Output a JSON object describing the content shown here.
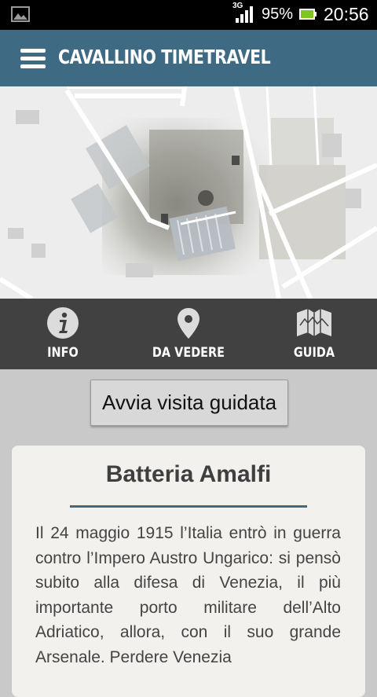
{
  "status_bar": {
    "network_label": "3G",
    "battery_percent": "95%",
    "time": "20:56",
    "icons": [
      "image-notification-icon",
      "signal-icon",
      "battery-icon"
    ]
  },
  "app_bar": {
    "title": "CAVALLINO TIMETRAVEL",
    "menu_icon": "hamburger-menu-icon"
  },
  "map": {
    "description_icon": "aerial-map"
  },
  "tabs": [
    {
      "label": "INFO",
      "icon": "info-icon"
    },
    {
      "label": "DA VEDERE",
      "icon": "location-pin-icon"
    },
    {
      "label": "GUIDA",
      "icon": "map-guide-icon"
    }
  ],
  "guide_button": {
    "label": "Avvia visita guidata"
  },
  "card": {
    "title": "Batteria Amalfi",
    "body": "Il 24 maggio 1915 l’Italia entrò in guerra contro l’Impero Austro Ungarico: si pensò subito alla difesa di Venezia, il più importante porto militare dell’Alto Adriatico, allora, con il suo grande Arsenale. Perdere Venezia"
  },
  "colors": {
    "app_bar": "#3e6a84",
    "tab_bar": "#414141",
    "background": "#c9c9c9",
    "card": "#f2f1ee",
    "accent_rule": "#3e6a84"
  }
}
